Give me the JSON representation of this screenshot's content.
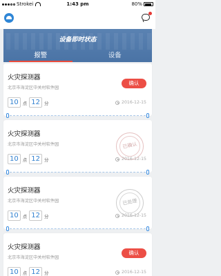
{
  "status_bar": {
    "carrier": "Strokei",
    "time": "1:43 pm",
    "battery": "80%"
  },
  "header": {
    "title": "设备即时状态",
    "tabs": [
      {
        "label": "报警",
        "active": true
      },
      {
        "label": "设备",
        "active": false
      }
    ]
  },
  "items": [
    {
      "title": "火灾探测器",
      "address": "北京市海淀区中关村软件园",
      "hour": "10",
      "hour_unit": "点",
      "minute": "12",
      "minute_unit": "分",
      "date": "2016-12-15",
      "action": "确认",
      "state": "pending"
    },
    {
      "title": "火灾探测器",
      "address": "北京市海淀区中关村软件园",
      "hour": "10",
      "hour_unit": "点",
      "minute": "12",
      "minute_unit": "分",
      "date": "2016-12-15",
      "stamp": "已确认",
      "state": "confirmed"
    },
    {
      "title": "火灾探测器",
      "address": "北京市海淀区中关村软件园",
      "hour": "10",
      "hour_unit": "点",
      "minute": "12",
      "minute_unit": "分",
      "date": "2016-12-15",
      "stamp": "已处理",
      "state": "processed"
    },
    {
      "title": "火灾探测器",
      "address": "北京市海淀区中关村软件园",
      "hour": "10",
      "hour_unit": "点",
      "minute": "12",
      "minute_unit": "分",
      "date": "2016-12-15",
      "action": "确认",
      "state": "pending"
    }
  ],
  "colors": {
    "accent_blue": "#2f7fcf",
    "header_blue": "#4a73a5",
    "confirm_red": "#ec4e45"
  }
}
